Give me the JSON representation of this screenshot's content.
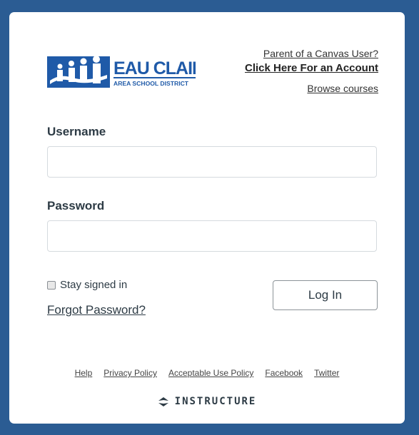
{
  "header": {
    "logo_name": "EAU CLAIRE",
    "logo_sub": "AREA SCHOOL DISTRICT",
    "parent_link": "Parent of a Canvas User?",
    "account_link": "Click Here For an Account",
    "browse_link": "Browse courses"
  },
  "form": {
    "username_label": "Username",
    "username_value": "",
    "password_label": "Password",
    "password_value": "",
    "stay_signed_in": "Stay signed in",
    "stay_signed_in_checked": false,
    "forgot_password": "Forgot Password?",
    "login_button": "Log In"
  },
  "footer": {
    "links": [
      "Help",
      "Privacy Policy",
      "Acceptable Use Policy",
      "Facebook",
      "Twitter"
    ],
    "brand": "INSTRUCTURE"
  },
  "colors": {
    "background": "#2b5c93",
    "logo_blue": "#1f5aa8",
    "text": "#2d3b45"
  }
}
